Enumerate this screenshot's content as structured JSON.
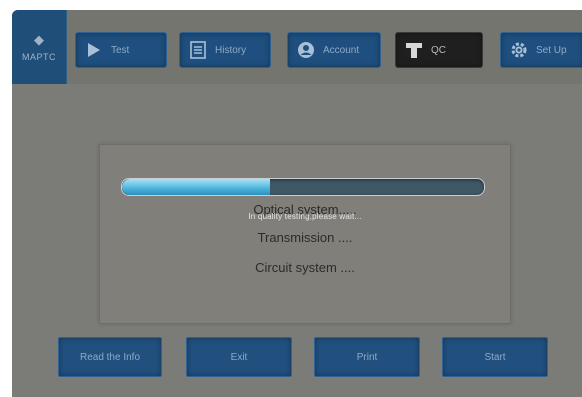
{
  "nav": {
    "home_label": "MAPTC",
    "items": [
      {
        "label": "Test",
        "icon": "play-icon"
      },
      {
        "label": "History",
        "icon": "history-icon"
      },
      {
        "label": "Account",
        "icon": "account-icon"
      },
      {
        "label": "QC",
        "icon": "qc-icon",
        "active": true
      },
      {
        "label": "Set Up",
        "icon": "gear-icon"
      }
    ]
  },
  "dialog": {
    "progress": 0.41,
    "message": "In quality testing,please wait...",
    "systems": [
      "Optical system.....",
      "Transmission ....",
      "Circuit system ...."
    ]
  },
  "bottom": {
    "buttons": [
      "Read the Info",
      "Exit",
      "Print",
      "Start"
    ]
  },
  "colors": {
    "background": "#7b7b78",
    "button_blue": "#1f4f7e",
    "active_tab": "#1f1f1f",
    "progress_fill": "#4bb4dc"
  }
}
